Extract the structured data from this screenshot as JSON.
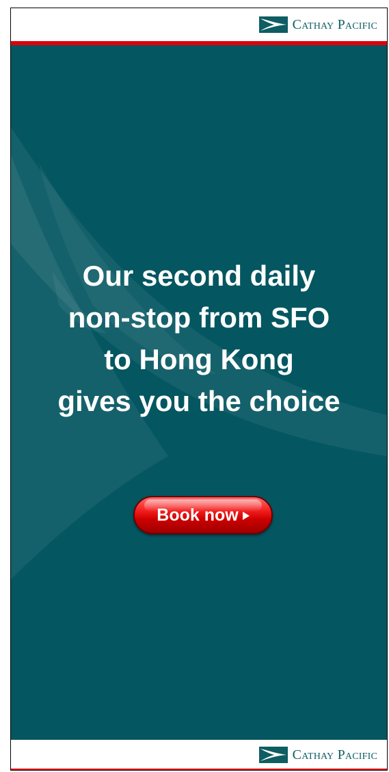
{
  "brand": {
    "name": "Cathay Pacific",
    "mark_icon": "cathay-brushwing-icon",
    "color": "#0e5d63",
    "accent_red": "#e0000b"
  },
  "ad": {
    "background_color": "#045660",
    "headline_lines": [
      "Our second daily",
      "non-stop from SFO",
      "to Hong Kong",
      "gives you the choice"
    ],
    "cta": {
      "label": "Book now",
      "arrow_icon": "play-arrow-icon",
      "color": "#e00000"
    }
  }
}
